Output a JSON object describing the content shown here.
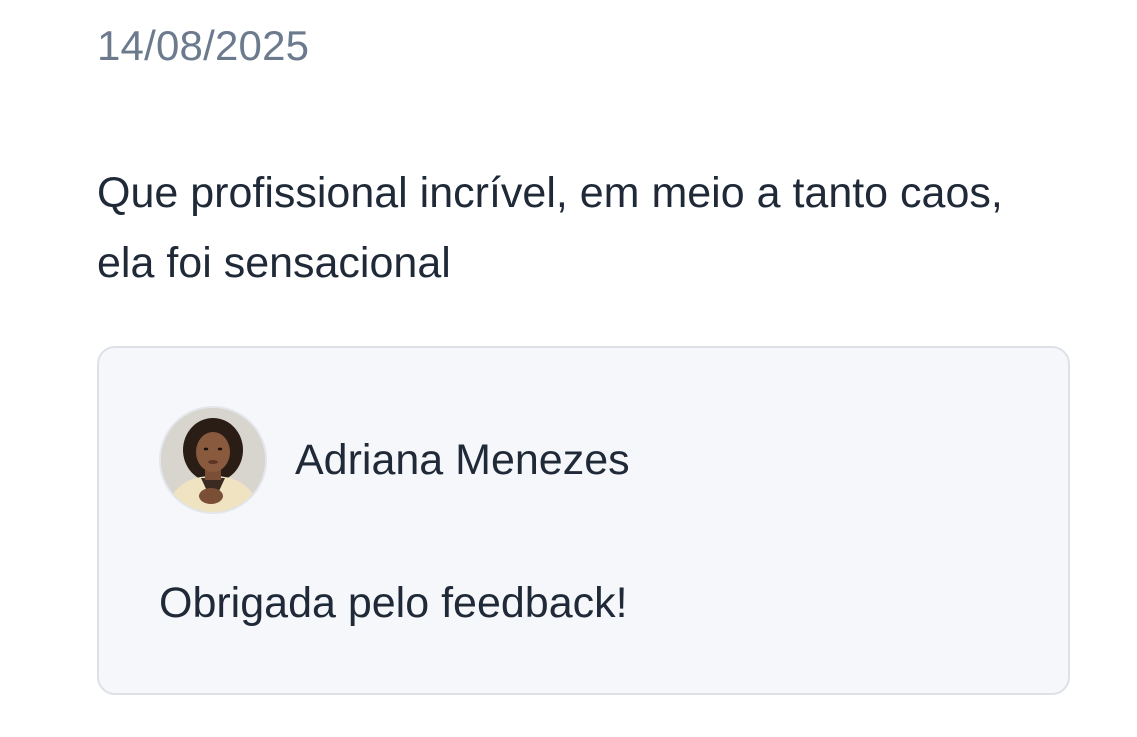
{
  "review": {
    "date": "14/08/2025",
    "comment": "Que profissional incrível, em meio a tanto caos, ela foi sensacional",
    "reply": {
      "author": "Adriana Menezes",
      "avatar_icon": "person-avatar-photo",
      "text": "Obrigada pelo feedback!"
    }
  }
}
